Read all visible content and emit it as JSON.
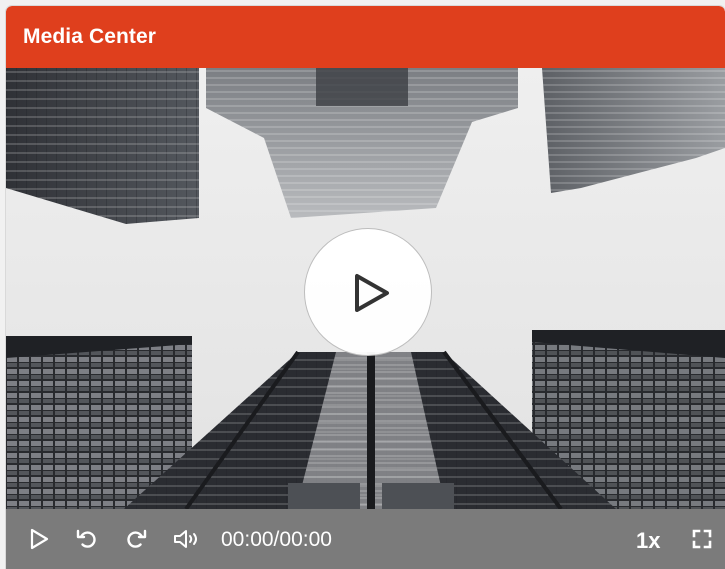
{
  "header": {
    "title": "Media Center",
    "color": "#df3f1d"
  },
  "video": {
    "description_icon": "video-frame",
    "big_play_icon": "play-icon"
  },
  "controls": {
    "background": "#7b7b7b",
    "play_icon": "play-icon",
    "rewind_icon": "rewind-icon",
    "forward_icon": "forward-icon",
    "volume_icon": "volume-icon",
    "time": "00:00/00:00",
    "speed": "1x",
    "fullscreen_icon": "fullscreen-icon"
  }
}
